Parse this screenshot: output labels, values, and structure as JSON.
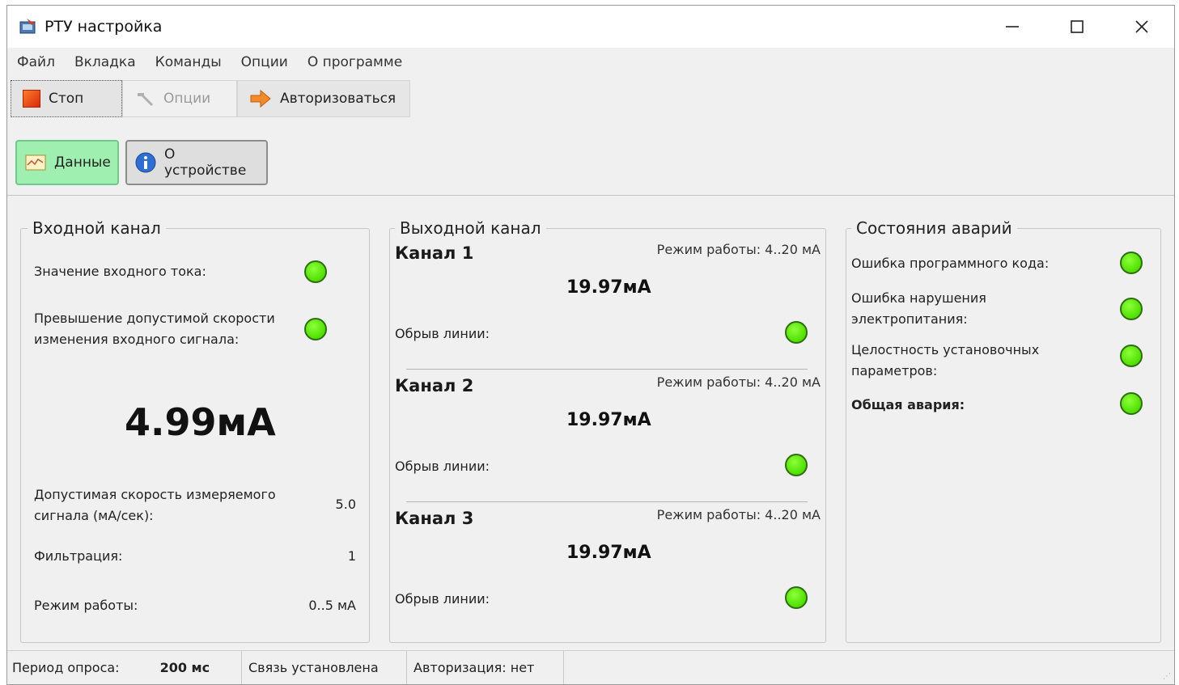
{
  "window": {
    "title": "РТУ настройка"
  },
  "menu": [
    "Файл",
    "Вкладка",
    "Команды",
    "Опции",
    "О программе"
  ],
  "toolbar": {
    "stop": "Стоп",
    "options": "Опции",
    "auth": "Авторизоваться"
  },
  "tabs": {
    "data": "Данные",
    "device": "О устройстве"
  },
  "input_channel": {
    "title": "Входной канал",
    "current_label": "Значение входного тока:",
    "rate_exceed_label_1": "Превышение допустимой скорости",
    "rate_exceed_label_2": "изменения входного сигнала:",
    "value": "4.99мА",
    "allowed_rate_label_1": "Допустимая скорость измеряемого",
    "allowed_rate_label_2": "сигнала (мА/сек):",
    "allowed_rate_value": "5.0",
    "filter_label": "Фильтрация:",
    "filter_value": "1",
    "mode_label": "Режим работы:",
    "mode_value": "0..5 мА"
  },
  "output_channel": {
    "title": "Выходной канал",
    "channels": [
      {
        "name": "Канал 1",
        "mode": "Режим работы: 4..20 мА",
        "value": "19.97мА",
        "break_label": "Обрыв линии:"
      },
      {
        "name": "Канал 2",
        "mode": "Режим работы: 4..20 мА",
        "value": "19.97мА",
        "break_label": "Обрыв линии:"
      },
      {
        "name": "Канал 3",
        "mode": "Режим работы: 4..20 мА",
        "value": "19.97мА",
        "break_label": "Обрыв линии:"
      }
    ]
  },
  "alarms": {
    "title": "Состояния аварий",
    "code_error": "Ошибка программного кода:",
    "power_error_1": "Ошибка нарушения",
    "power_error_2": "электропитания:",
    "integrity_1": "Целостность установочных",
    "integrity_2": "параметров:",
    "general": "Общая авария:"
  },
  "status": {
    "period_label": "Период опроса:",
    "period_value": "200 мс",
    "connection": "Связь установлена",
    "authorization": "Авторизация: нет"
  },
  "colors": {
    "led_on": "#4fe000",
    "active_tab": "#9ff0b0"
  }
}
